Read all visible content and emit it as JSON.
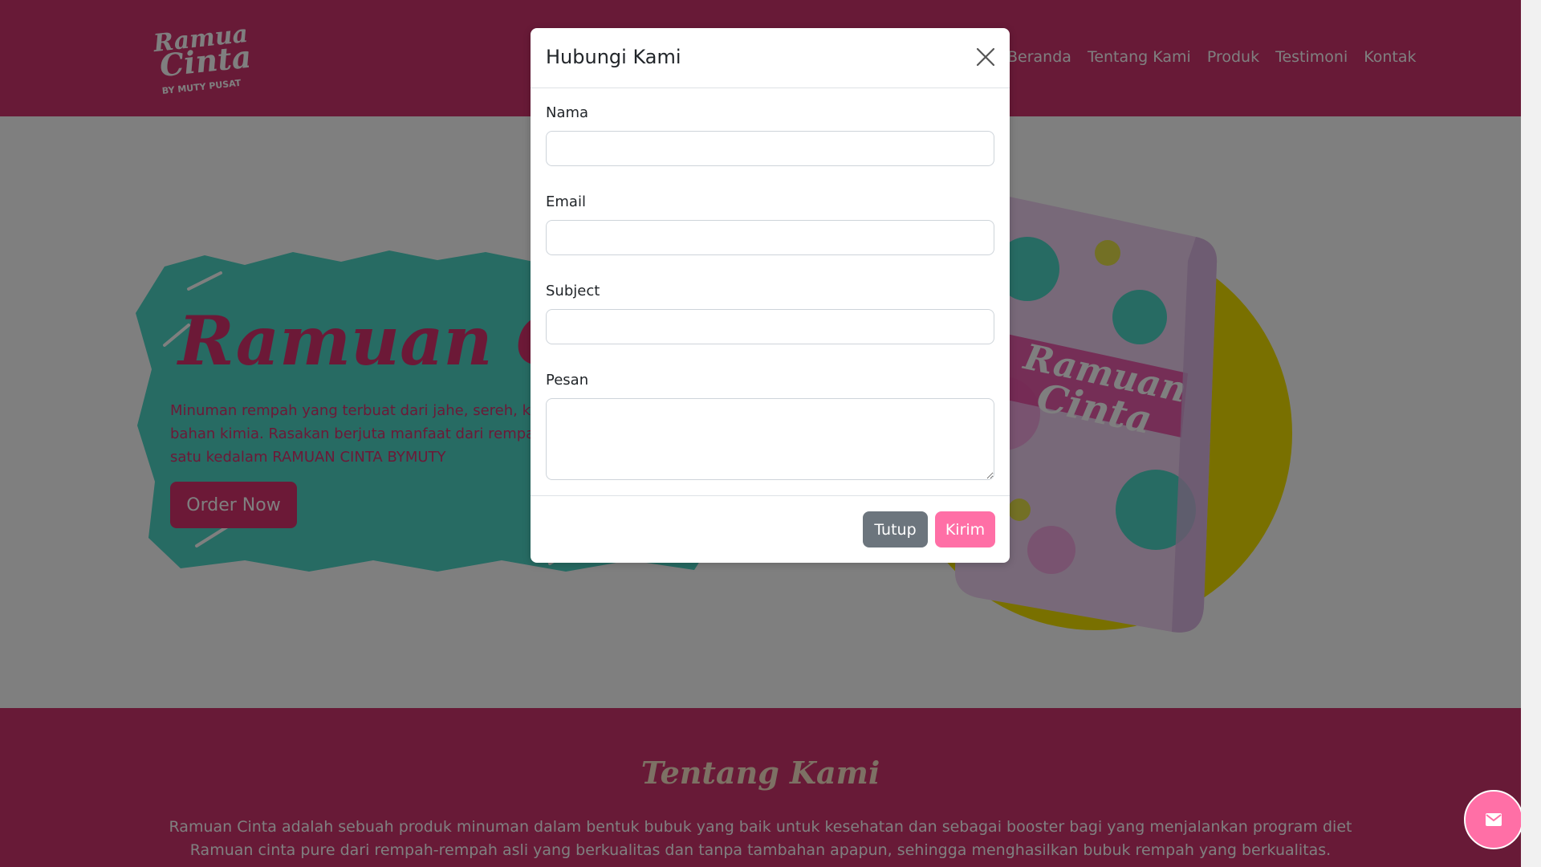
{
  "colors": {
    "brand_pink": "#d0346f",
    "accent_pink": "#ff6fa6",
    "teal": "#4fd6c6",
    "yellow": "#f2e100",
    "secondary_gray": "#6c757d"
  },
  "navbar": {
    "logo": {
      "line1": "Ramuan",
      "line2": "Cinta",
      "line3": "BY MUTY PUSAT"
    },
    "links": [
      "Beranda",
      "Tentang Kami",
      "Produk",
      "Testimoni",
      "Kontak"
    ]
  },
  "hero": {
    "title": "Ramuan Cinta",
    "description": "Minuman rempah yang terbuat dari jahe, sereh, kunyit, tanpa bahan kimia. Rasakan berjuta manfaat dari rempah menjadi satu kedalam RAMUAN CINTA BYMUTY",
    "order_label": "Order Now"
  },
  "about": {
    "title": "Tentang Kami",
    "text": "Ramuan Cinta adalah sebuah produk minuman dalam bentuk bubuk yang baik untuk kesehatan dan sebagai booster bagi yang menjalankan program diet Ramuan cinta pure dari rempah-rempah asli yang berkualitas dan tanpa tambahan apapun, sehingga menghasilkan bubuk rempah yang berkualitas."
  },
  "modal": {
    "title": "Hubungi Kami",
    "fields": {
      "name_label": "Nama",
      "email_label": "Email",
      "subject_label": "Subject",
      "message_label": "Pesan"
    },
    "buttons": {
      "close_label": "Tutup",
      "send_label": "Kirim"
    }
  },
  "icons": {
    "close": "close-icon",
    "chat": "envelope-icon"
  }
}
